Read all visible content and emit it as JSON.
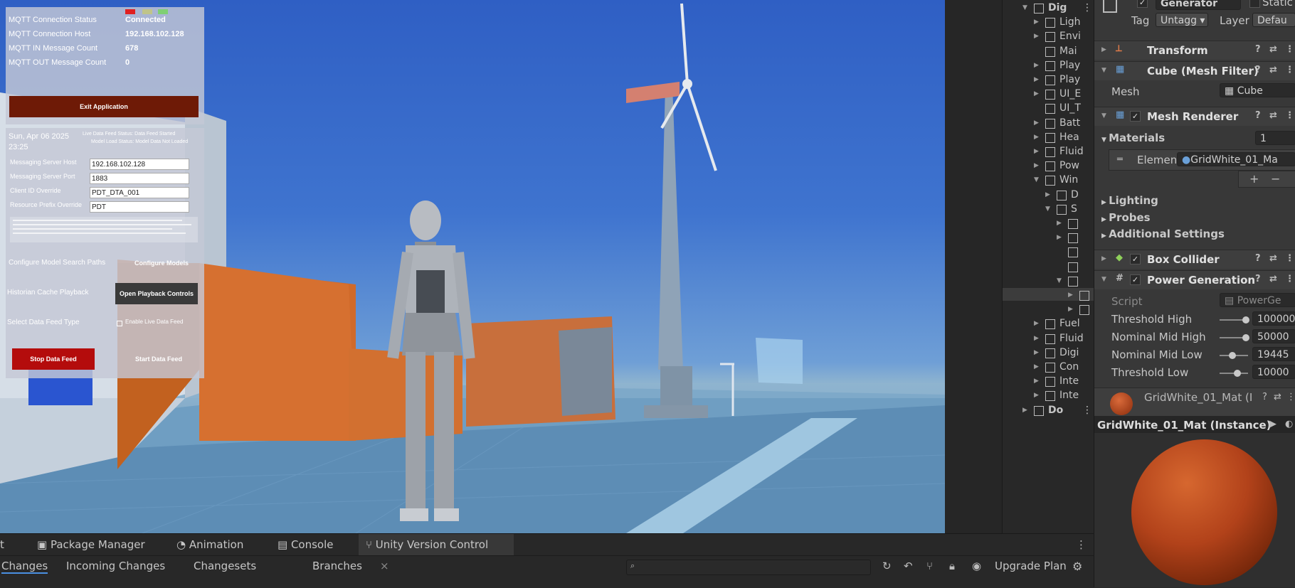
{
  "hud": {
    "status": [
      {
        "label": "MQTT Connection Status",
        "value": "Connected"
      },
      {
        "label": "MQTT Connection Host",
        "value": "192.168.102.128"
      },
      {
        "label": "MQTT IN Message Count",
        "value": "678"
      },
      {
        "label": "MQTT OUT Message Count",
        "value": "0"
      }
    ],
    "exit_button": "Exit Application",
    "date": "Sun, Apr 06 2025",
    "time": "23:25",
    "live_feed_status": "Live Data Feed Status: Data Feed Started",
    "model_load_status": "Model Load Status: Model Data Not Loaded",
    "fields": [
      {
        "label": "Messaging Server Host",
        "value": "192.168.102.128"
      },
      {
        "label": "Messaging Server Port",
        "value": "1883"
      },
      {
        "label": "Client ID Override",
        "value": "PDT_DTA_001"
      },
      {
        "label": "Resource Prefix Override",
        "value": "PDT"
      }
    ],
    "configure_paths_label": "Configure Model Search Paths",
    "configure_models_button": "Configure Models",
    "historian_label": "Historian Cache Playback",
    "playback_button": "Open Playback Controls",
    "data_feed_label": "Select Data Feed Type",
    "enable_live_label": "Enable Live Data Feed",
    "stop_button": "Stop Data Feed",
    "start_button": "Start Data Feed",
    "colors": {
      "exit": "#6e1a06",
      "stop": "#b40c0c",
      "dark_button": "#3a3a3a"
    }
  },
  "hierarchy": {
    "rows": [
      {
        "label": "Dig",
        "depth": 0,
        "expanded": true
      },
      {
        "label": "Ligh",
        "depth": 1,
        "expanded": false
      },
      {
        "label": "Envi",
        "depth": 1,
        "expanded": false
      },
      {
        "label": "Mai",
        "depth": 1,
        "expanded": null
      },
      {
        "label": "Play",
        "depth": 1,
        "expanded": false
      },
      {
        "label": "Play",
        "depth": 1,
        "expanded": false
      },
      {
        "label": "UI_E",
        "depth": 1,
        "expanded": false
      },
      {
        "label": "UI_T",
        "depth": 1,
        "expanded": null
      },
      {
        "label": "Batt",
        "depth": 1,
        "expanded": false
      },
      {
        "label": "Hea",
        "depth": 1,
        "expanded": false
      },
      {
        "label": "Fluid",
        "depth": 1,
        "expanded": false
      },
      {
        "label": "Pow",
        "depth": 1,
        "expanded": false
      },
      {
        "label": "Win",
        "depth": 1,
        "expanded": true
      },
      {
        "label": "D",
        "depth": 2,
        "expanded": false
      },
      {
        "label": "S",
        "depth": 2,
        "expanded": true
      },
      {
        "label": "",
        "depth": 3,
        "expanded": false
      },
      {
        "label": "",
        "depth": 3,
        "expanded": false
      },
      {
        "label": "",
        "depth": 3,
        "expanded": null
      },
      {
        "label": "",
        "depth": 3,
        "expanded": null
      },
      {
        "label": "",
        "depth": 3,
        "expanded": true
      },
      {
        "label": "",
        "depth": 4,
        "expanded": false
      },
      {
        "label": "",
        "depth": 4,
        "expanded": false
      },
      {
        "label": "Fuel",
        "depth": 1,
        "expanded": false
      },
      {
        "label": "Fluid",
        "depth": 1,
        "expanded": false
      },
      {
        "label": "Digi",
        "depth": 1,
        "expanded": false
      },
      {
        "label": "Con",
        "depth": 1,
        "expanded": false
      },
      {
        "label": "Inte",
        "depth": 1,
        "expanded": false
      },
      {
        "label": "Inte",
        "depth": 1,
        "expanded": false
      },
      {
        "label": "Do",
        "depth": 0,
        "expanded": false
      }
    ]
  },
  "inspector": {
    "object_name": "Generator",
    "static_label": "Static",
    "tag_label": "Tag",
    "tag_value": "Untagg",
    "layer_label": "Layer",
    "layer_value": "Defau",
    "components": {
      "transform": "Transform",
      "mesh_filter": "Cube (Mesh Filter)",
      "mesh_label": "Mesh",
      "mesh_value": "Cube",
      "mesh_renderer": "Mesh Renderer",
      "materials_label": "Materials",
      "materials_count": "1",
      "element_label": "Elemen",
      "element_value": "GridWhite_01_Ma",
      "lighting": "Lighting",
      "probes": "Probes",
      "additional": "Additional Settings",
      "box_collider": "Box Collider",
      "power_gen": "Power Generation",
      "script_label": "Script",
      "script_value": "PowerGe"
    },
    "thresholds": [
      {
        "label": "Threshold High",
        "value": "100000",
        "level": 0.9
      },
      {
        "label": "Nominal Mid High",
        "value": "50000",
        "level": 0.9
      },
      {
        "label": "Nominal Mid Low",
        "value": "19445",
        "level": 0.35
      },
      {
        "label": "Threshold Low",
        "value": "10000",
        "level": 0.55
      }
    ],
    "material_name": "GridWhite_01_Mat (I",
    "preview_title": "GridWhite_01_Mat (Instance)",
    "material_color": "#b2421a"
  },
  "bottom": {
    "tabs": [
      "t",
      "Package Manager",
      "Animation",
      "Console",
      "Unity Version Control"
    ],
    "subtabs": [
      "Changes",
      "Incoming Changes",
      "Changesets",
      "Branches"
    ],
    "close_glyph": "×",
    "upgrade": "Upgrade Plan"
  }
}
